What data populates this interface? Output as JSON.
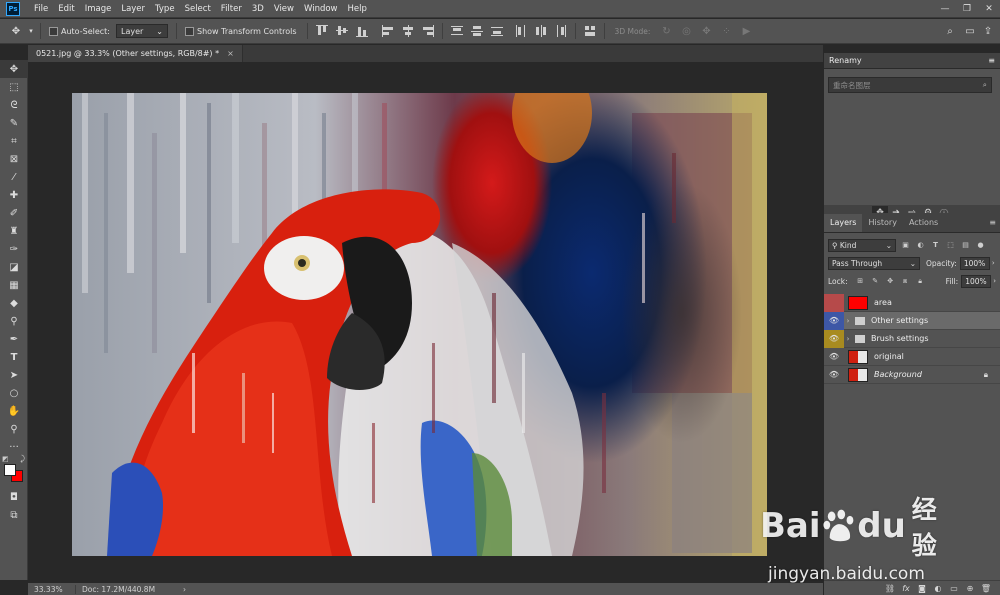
{
  "menu": {
    "logo": "Ps",
    "items": [
      "File",
      "Edit",
      "Image",
      "Layer",
      "Type",
      "Select",
      "Filter",
      "3D",
      "View",
      "Window",
      "Help"
    ]
  },
  "options": {
    "auto_select_label": "Auto-Select:",
    "auto_select_target": "Layer",
    "show_transform_label": "Show Transform Controls",
    "mode_3d_label": "3D Mode:"
  },
  "document": {
    "tab_title": "0521.jpg @ 33.3% (Other settings, RGB/8#) *",
    "close_symbol": "×"
  },
  "status": {
    "zoom": "33.33%",
    "doc_info": "Doc: 17.2M/440.8M",
    "arrow": "›"
  },
  "renamy": {
    "title": "Renamy",
    "search_placeholder": "重命名图层"
  },
  "layers_panel": {
    "tabs": [
      "Layers",
      "History",
      "Actions"
    ],
    "filter_kind": "Kind",
    "blend_mode": "Pass Through",
    "opacity_label": "Opacity:",
    "opacity_value": "100%",
    "lock_label": "Lock:",
    "fill_label": "Fill:",
    "fill_value": "100%",
    "layers": [
      {
        "name": "area",
        "type": "fill",
        "eye_color": "red",
        "thumb_color": "#ff0000"
      },
      {
        "name": "Other settings",
        "type": "group",
        "eye_color": "blue",
        "selected": true
      },
      {
        "name": "Brush settings",
        "type": "group",
        "eye_color": "yellow"
      },
      {
        "name": "original",
        "type": "image"
      },
      {
        "name": "Background",
        "type": "image",
        "italic": true,
        "locked": true
      }
    ]
  },
  "colors": {
    "foreground": "#ffffff",
    "background": "#ff0000",
    "ui_panel": "#535353",
    "ui_dark": "#282828"
  },
  "watermark": {
    "brand_left": "Bai",
    "brand_right": "du",
    "brand_cn": "经验",
    "url": "jingyan.baidu.com"
  }
}
